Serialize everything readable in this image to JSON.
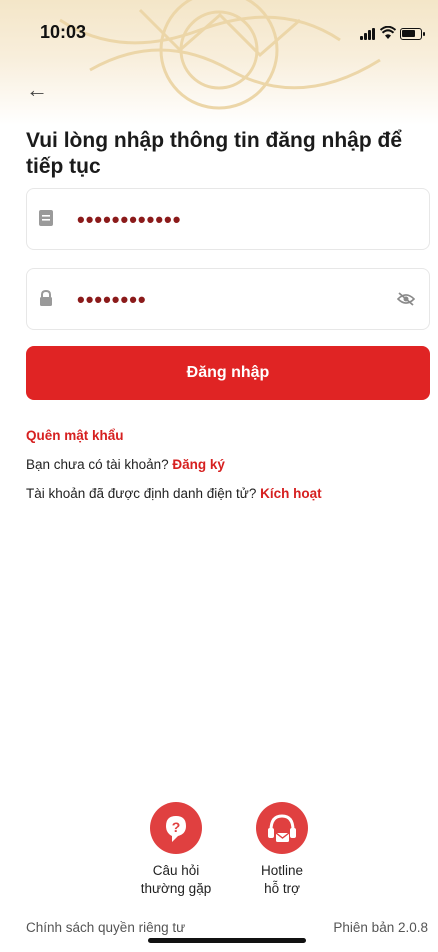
{
  "status_bar": {
    "time": "10:03"
  },
  "heading": "Vui lòng nhập thông tin đăng nhập để tiếp tục",
  "username": {
    "value": "••••••••••••"
  },
  "password": {
    "value": "••••••••"
  },
  "login_button": "Đăng nhập",
  "forgot_password": "Quên mật khẩu",
  "register": {
    "prompt": "Bạn chưa có tài khoản?",
    "link": "Đăng ký"
  },
  "activate": {
    "prompt": "Tài khoản đã được định danh điện tử?",
    "link": "Kích hoạt"
  },
  "support": [
    {
      "line1": "Câu hỏi",
      "line2": "thường gặp"
    },
    {
      "line1": "Hotline",
      "line2": "hỗ trợ"
    }
  ],
  "footer": {
    "privacy": "Chính sách quyền riêng tư",
    "version": "Phiên bản 2.0.8"
  },
  "colors": {
    "accent": "#e02424",
    "masked_text": "#8b1a1a"
  }
}
